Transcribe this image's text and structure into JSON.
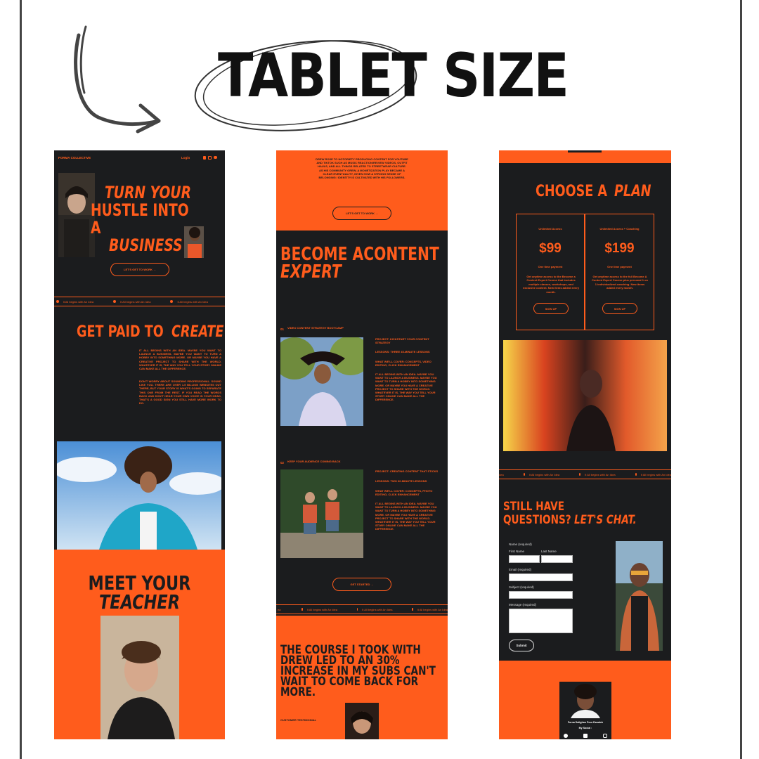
{
  "heading": "TABLET SIZE",
  "panel1": {
    "brand": "FORMA COLLECTIVE",
    "login": "Login",
    "hero_line1": "TURN YOUR",
    "hero_line2": "HUSTLE INTO A",
    "hero_line3": "BUSINESS",
    "cta": "LET'S GET TO WORK →",
    "ticker": "It All begins with An Idea",
    "paid_title_a": "GET PAID TO ",
    "paid_title_b": "CREATE",
    "paid_p1": "IT ALL BEGINS WITH AN IDEA. MAYBE YOU WANT TO LAUNCH A BUSINESS. MAYBE YOU WANT TO TURN A HOBBY INTO SOMETHING MORE. OR MAYBE YOU HAVE A CREATIVE PROJECT TO SHARE WITH THE WORLD. WHATEVER IT IS, THE WAY YOU TELL YOUR STORY ONLINE CAN MAKE ALL THE DIFFERENCE.",
    "paid_p2": "DON'T WORRY ABOUT SOUNDING PROFESSIONAL. SOUND LIKE YOU. THERE ARE OVER 1.5 BILLION WEBSITES OUT THERE, BUT YOUR STORY IS WHAT'S GOING TO SEPARATE THIS ONE FROM THE REST. IF YOU READ THE WORDS BACK AND DON'T HEAR YOUR OWN VOICE IN YOUR HEAD, THAT'S A GOOD SIGN YOU STILL HAVE MORE WORK TO DO.",
    "teacher_line1": "MEET YOUR",
    "teacher_line2": "TEACHER"
  },
  "panel2": {
    "intro": "DREW ROSE TO NOTORIETY PRODUCING CONTENT FOR YOUTUBE AND TIKTOK SUCH AS MUSIC REACTION/REVIEW VIDEOS, OUTFIT HAULS, AND ALL THINGS RELATED TO STREETWEAR CULTURE. AS HIS COMMUNITY GREW, A MONETIZATION PLAY BECAME A CLEAR EVENTUALITY, GIVEN HOW A STRONG SENSE OF BELONGING / IDENTITY IS CULTIVATED WITH HIS FOLLOWERS.",
    "cta": "LET'S GET TO WORK →",
    "title_line1": "BECOME ACONTENT",
    "title_line2": "EXPERT",
    "m1_num": "01",
    "m1_title": "VIDEO CONTENT STRATEGY BOOTCAMP",
    "m1_project": "PROJECT: KICKSTART YOUR CONTENT STRATEGY",
    "m1_lessons": "LESSONS: THREE 45-MINUTE LESSONS",
    "m1_cover": "WHAT WE'LL COVER: CONCEPTS, VIDEO EDITING, CLICK ENHANCEMENT",
    "m1_body": "IT ALL BEGINS WITH AN IDEA. MAYBE YOU WANT TO LAUNCH A BUSINESS. MAYBE YOU WANT TO TURN A HOBBY INTO SOMETHING MORE. OR MAYBE YOU HAVE A CREATIVE PROJECT TO SHARE WITH THE WORLD. WHATEVER IT IS, THE WAY YOU TELL YOUR STORY ONLINE CAN MAKE ALL THE DIFFERENCE.",
    "m2_num": "02",
    "m2_title": "KEEP YOUR AUDIENCE COMING BACK",
    "m2_project": "PROJECT: CREATING CONTENT THAT STICKS",
    "m2_lessons": "LESSONS: TWO 60-MINUTE LESSONS",
    "m2_cover": "WHAT WE'LL COVER: CONCEPTS, PHOTO EDITING, CLICK ENHANCEMENT",
    "m2_body": "IT ALL BEGINS WITH AN IDEA. MAYBE YOU WANT TO LAUNCH A BUSINESS. MAYBE YOU WANT TO TURN A HOBBY INTO SOMETHING MORE. OR MAYBE YOU HAVE A CREATIVE PROJECT TO SHARE WITH THE WORLD. WHATEVER IT IS, THE WAY YOU TELL YOUR STORY ONLINE CAN MAKE ALL THE DIFFERENCE.",
    "cta2": "GET STARTED →",
    "ticker": "It All begins with An Idea",
    "testimonial": "THE COURSE I TOOK WITH DREW LED TO AN 30% INCREASE IN MY SUBS CAN'T WAIT TO COME BACK FOR MORE.",
    "testimonial_label": "CUSTOMER TESTIMONIAL"
  },
  "panel3": {
    "plan_title_a": "CHOOSE A ",
    "plan_title_b": "PLAN",
    "plan1_name": "Unlimited Access",
    "plan1_price": "$99",
    "plan1_term": "One time payment",
    "plan1_desc": "Get anytime access to the Become a Content Expert Course that includes multiple classes, workshops, and exclusive content. New items added every month.",
    "plan1_btn": "Sign Up",
    "plan2_name": "Unlimited Access + Coaching",
    "plan2_price": "$199",
    "plan2_term": "One time payment",
    "plan2_desc": "Get anytime access to the full Become A Content Expert Course plus personal 1 on 1 individualized coaching. New items added every month.",
    "plan2_btn": "Sign Up",
    "ticker": "It All begins with An Idea",
    "chat_line1": "STILL HAVE",
    "chat_line2a": "QUESTIONS? ",
    "chat_line2b": "LET'S CHAT.",
    "name_label": "Name (required)",
    "first_label": "First Name",
    "last_label": "Last Name",
    "email_label": "Email (required)",
    "subject_label": "Subject (required)",
    "message_label": "Message (required)",
    "submit": "Submit",
    "footer_name": "Forna Dalighan Pour Danaleh",
    "footer_social": "My Social :"
  },
  "colors": {
    "orange": "#ff5c1c",
    "dark": "#1b1c1e"
  }
}
